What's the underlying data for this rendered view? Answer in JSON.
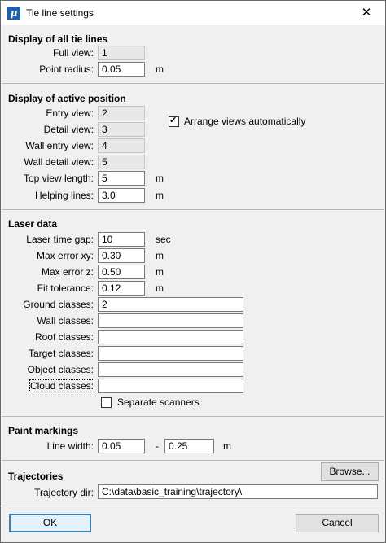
{
  "window": {
    "title": "Tie line settings",
    "close_glyph": "✕"
  },
  "display_all": {
    "heading": "Display of all tie lines",
    "full_view_label": "Full view:",
    "full_view_value": "1",
    "point_radius_label": "Point radius:",
    "point_radius_value": "0.05",
    "point_radius_unit": "m"
  },
  "display_active": {
    "heading": "Display of active position",
    "entry_view_label": "Entry view:",
    "entry_view_value": "2",
    "detail_view_label": "Detail view:",
    "detail_view_value": "3",
    "wall_entry_view_label": "Wall entry view:",
    "wall_entry_view_value": "4",
    "wall_detail_view_label": "Wall detail view:",
    "wall_detail_view_value": "5",
    "top_view_length_label": "Top view length:",
    "top_view_length_value": "5",
    "top_view_length_unit": "m",
    "helping_lines_label": "Helping lines:",
    "helping_lines_value": "3.0",
    "helping_lines_unit": "m",
    "arrange_label": "Arrange views automatically",
    "arrange_checked": true
  },
  "laser": {
    "heading": "Laser data",
    "time_gap_label": "Laser time gap:",
    "time_gap_value": "10",
    "time_gap_unit": "sec",
    "max_xy_label": "Max error xy:",
    "max_xy_value": "0.30",
    "max_xy_unit": "m",
    "max_z_label": "Max error z:",
    "max_z_value": "0.50",
    "max_z_unit": "m",
    "fit_tol_label": "Fit tolerance:",
    "fit_tol_value": "0.12",
    "fit_tol_unit": "m",
    "ground_label": "Ground classes:",
    "ground_value": "2",
    "wall_label": "Wall classes:",
    "wall_value": "",
    "roof_label": "Roof classes:",
    "roof_value": "",
    "target_label": "Target classes:",
    "target_value": "",
    "object_label": "Object classes:",
    "object_value": "",
    "cloud_label": "Cloud classes:",
    "cloud_value": "",
    "separate_label": "Separate scanners",
    "separate_checked": false
  },
  "paint": {
    "heading": "Paint markings",
    "line_width_label": "Line width:",
    "min_value": "0.05",
    "dash": "-",
    "max_value": "0.25",
    "unit": "m"
  },
  "trajectories": {
    "heading": "Trajectories",
    "browse_label": "Browse...",
    "dir_label": "Trajectory dir:",
    "dir_value": "C:\\data\\basic_training\\trajectory\\"
  },
  "footer": {
    "ok_label": "OK",
    "cancel_label": "Cancel"
  }
}
